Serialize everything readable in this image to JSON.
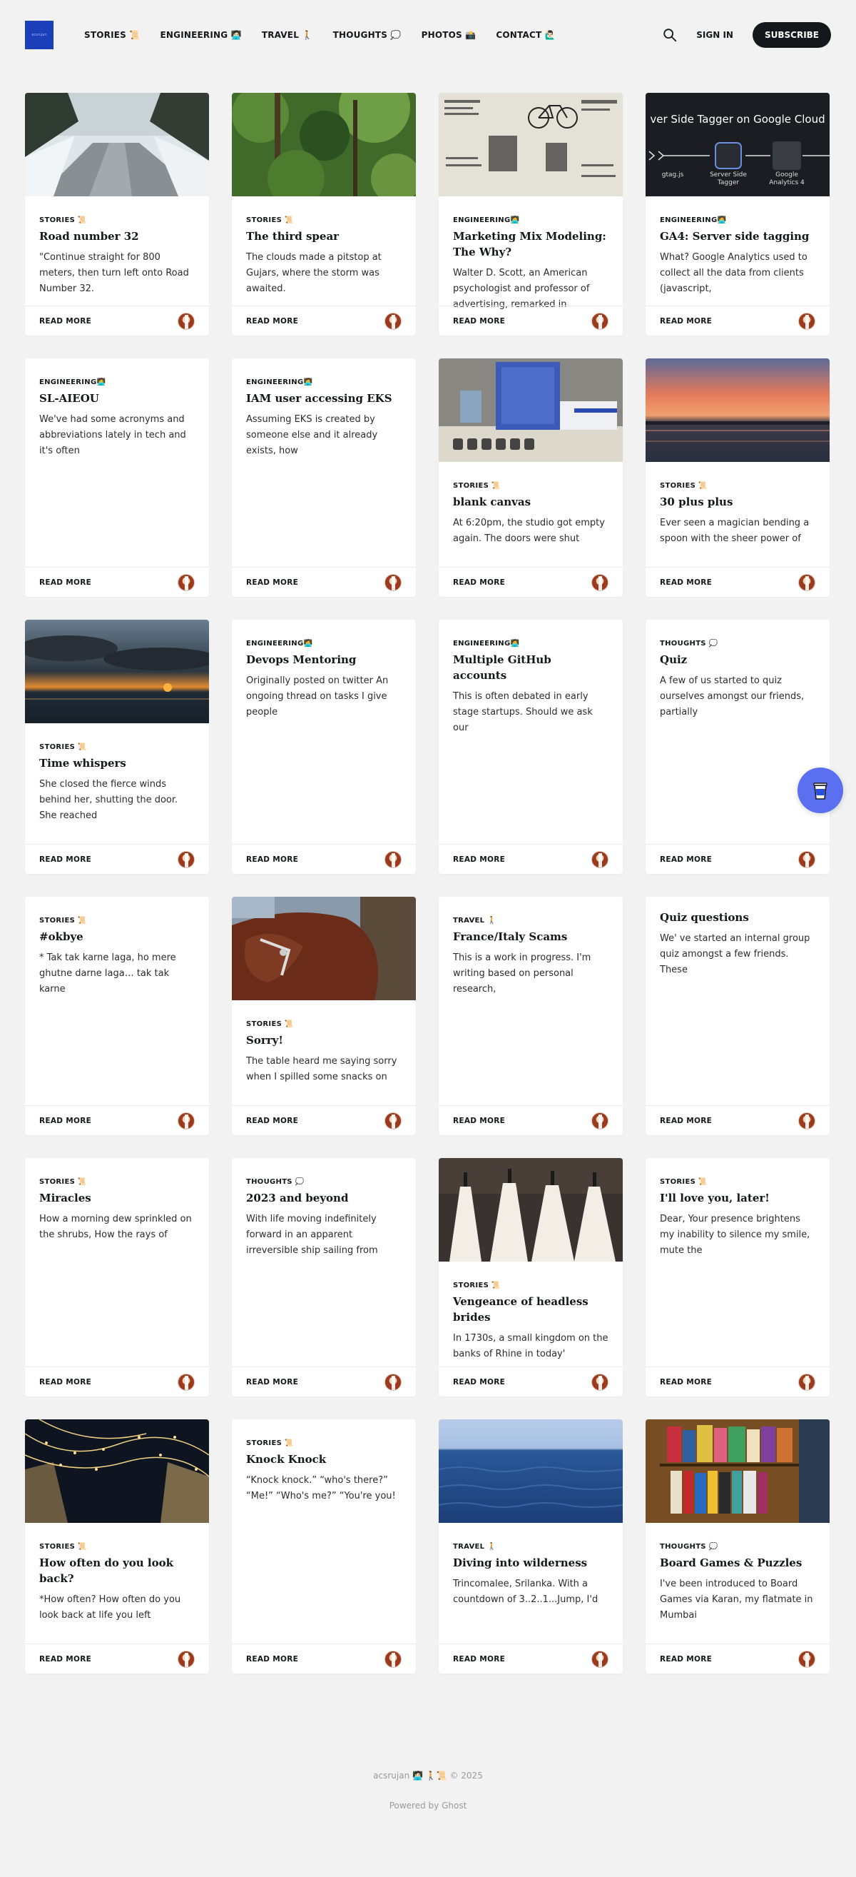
{
  "header": {
    "logo_text": "acsrujan",
    "nav": [
      "STORIES 📜",
      "ENGINEERING 🧑🏻‍💻",
      "TRAVEL 🚶",
      "THOUGHTS 💭",
      "PHOTOS 📸",
      "CONTACT 🙋🏻‍♂️"
    ],
    "signin": "SIGN IN",
    "subscribe": "SUBSCRIBE"
  },
  "read_more": "READ MORE",
  "rows": [
    [
      {
        "image": "snow-road",
        "tag": "STORIES 📜",
        "title": "Road number 32",
        "excerpt": "\"Continue straight for 800 meters, then turn left onto Road Number 32."
      },
      {
        "image": "forest",
        "tag": "STORIES 📜",
        "title": "The third spear",
        "excerpt": "The clouds made a pitstop at Gujars, where the storm was awaited."
      },
      {
        "image": "newspaper",
        "tag": "ENGINEERING🧑‍💻",
        "title": "Marketing Mix Modeling: The Why?",
        "excerpt": "Walter D. Scott, an American psychologist and professor of advertising, remarked in"
      },
      {
        "image": "tagger",
        "image_text": {
          "headline": "ver Side Tagger on Google Cloud",
          "left": "gtag.js",
          "mid": "Server Side Tagger",
          "right": "Google Analytics 4"
        },
        "tag": "ENGINEERING🧑‍💻",
        "title": "GA4: Server side tagging",
        "excerpt": "What? Google Analytics used to collect all the data from clients (javascript,"
      }
    ],
    [
      {
        "image": null,
        "tag": "ENGINEERING🧑‍💻",
        "title": "SL-AIEOU",
        "excerpt": "We've had some acronyms and abbreviations lately in tech and it's often"
      },
      {
        "image": null,
        "tag": "ENGINEERING🧑‍💻",
        "title": "IAM user accessing EKS",
        "excerpt": "Assuming EKS is created by someone else and it already exists, how"
      },
      {
        "image": "blue-canvas",
        "tag": "STORIES 📜",
        "title": "blank canvas",
        "excerpt": "At 6:20pm, the studio got empty again. The doors were shut"
      },
      {
        "image": "sunset-lake",
        "tag": "STORIES 📜",
        "title": "30 plus plus",
        "excerpt": "Ever seen a magician bending a spoon with the sheer power of"
      }
    ],
    [
      {
        "image": "sea-sunset",
        "tag": "STORIES 📜",
        "title": "Time whispers",
        "excerpt": "She closed the fierce winds behind her, shutting the door. She reached"
      },
      {
        "image": null,
        "tag": "ENGINEERING🧑‍💻",
        "title": "Devops Mentoring",
        "excerpt": "Originally posted on twitter An ongoing thread on tasks I give people"
      },
      {
        "image": null,
        "tag": "ENGINEERING🧑‍💻",
        "title": "Multiple GitHub accounts",
        "excerpt": "This is often debated in early stage startups. Should we ask our"
      },
      {
        "image": null,
        "tag": "THOUGHTS 💭",
        "title": "Quiz",
        "excerpt": "A few of us started to quiz ourselves amongst our friends, partially"
      }
    ],
    [
      {
        "image": null,
        "tag": "STORIES 📜",
        "title": "#okbye",
        "excerpt": "* Tak tak karne laga, ho mere ghutne darne laga… tak tak karne"
      },
      {
        "image": "horse",
        "tag": "STORIES 📜",
        "title": "Sorry!",
        "excerpt": "The table heard me saying sorry when I spilled some snacks on"
      },
      {
        "image": null,
        "tag": "TRAVEL 🚶",
        "title": "France/Italy Scams",
        "excerpt": "This is a work in progress. I'm writing based on personal research,"
      },
      {
        "image": null,
        "tag": "",
        "title": "Quiz questions",
        "excerpt": "We' ve started an internal group quiz amongst a few friends. These"
      }
    ],
    [
      {
        "image": null,
        "tag": "STORIES 📜",
        "title": "Miracles",
        "excerpt": "How a morning dew sprinkled on the shrubs, How the rays of"
      },
      {
        "image": null,
        "tag": "THOUGHTS 💭",
        "title": "2023 and beyond",
        "excerpt": "With life moving indefinitely forward in an apparent irreversible ship sailing from"
      },
      {
        "image": "brides",
        "tag": "STORIES 📜",
        "title": "Vengeance of headless brides",
        "excerpt": "In 1730s, a small kingdom on the banks of Rhine in today'"
      },
      {
        "image": null,
        "tag": "STORIES 📜",
        "title": "I'll love you, later!",
        "excerpt": "Dear, Your presence brightens my inability to silence my smile, mute the"
      }
    ],
    [
      {
        "image": "lights",
        "tag": "STORIES 📜",
        "title": "How often do you look back?",
        "excerpt": "*How often? How often do you look back at life you left"
      },
      {
        "image": null,
        "tag": "STORIES 📜",
        "title": "Knock Knock",
        "excerpt": "“Knock knock.” “who's there?” “Me!” “Who's me?” “You're you!"
      },
      {
        "image": "sea",
        "tag": "TRAVEL 🚶",
        "title": "Diving into wilderness",
        "excerpt": "Trincomalee, Srilanka. With a countdown of 3..2..1...Jump, I'd"
      },
      {
        "image": "boardgames",
        "tag": "THOUGHTS 💭",
        "title": "Board Games & Puzzles",
        "excerpt": "I've been introduced to Board Games via Karan, my flatmate in Mumbai"
      }
    ]
  ],
  "footer": {
    "copyright": "acsrujan 🧑🏻‍💻 🚶📜 © 2025",
    "powered": "Powered by Ghost"
  }
}
